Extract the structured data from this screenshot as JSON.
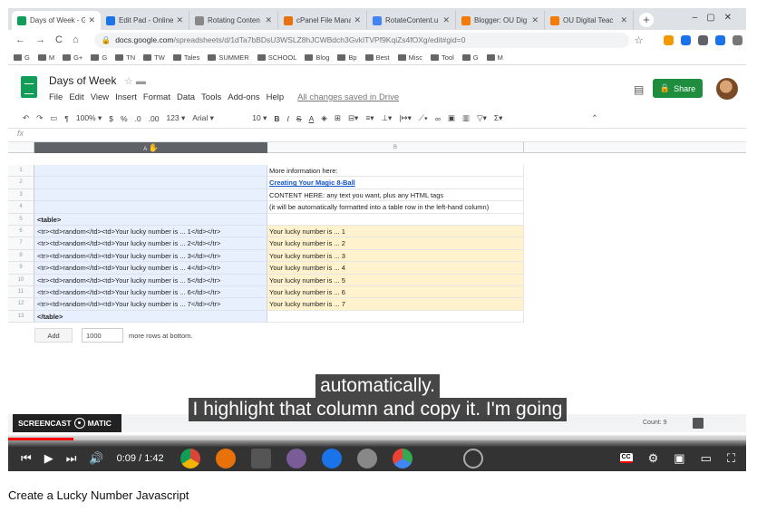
{
  "tabs": [
    {
      "label": "Days of Week - G",
      "color": "#0f9d58",
      "active": true
    },
    {
      "label": "Edit Pad - Online",
      "color": "#1a73e8",
      "active": false
    },
    {
      "label": "Rotating Conten",
      "color": "#888888",
      "active": false
    },
    {
      "label": "cPanel File Mana",
      "color": "#e8710a",
      "active": false
    },
    {
      "label": "RotateContent.u",
      "color": "#4285f4",
      "active": false
    },
    {
      "label": "Blogger: OU Dig",
      "color": "#f57c00",
      "active": false
    },
    {
      "label": "OU Digital Teac",
      "color": "#f57c00",
      "active": false
    }
  ],
  "omnibox": {
    "url_main": "docs.google.com",
    "url_rest": "/spreadsheets/d/1dTa7bBDsU3WSLZ8hJCWBdch3GvkITVPf9KqiZs4fOXg/edit#gid=0"
  },
  "bookmarks": [
    "G",
    "M",
    "G+",
    "G",
    "TN",
    "TW",
    "Tales",
    "SUMMER",
    "SCHOOL",
    "Blog",
    "Bp",
    "Best",
    "Misc",
    "Tool",
    "G",
    "M"
  ],
  "sheet": {
    "title": "Days of Week",
    "menu": [
      "File",
      "Edit",
      "View",
      "Insert",
      "Format",
      "Data",
      "Tools",
      "Add-ons",
      "Help"
    ],
    "saved_text": "All changes saved in Drive",
    "share_label": "Share"
  },
  "toolbar": {
    "zoom": "100%",
    "currency": "$",
    "percent": "%",
    "dec_less": ".0",
    "dec_more": ".00",
    "num_format": "123",
    "font": "Arial",
    "font_size": "10",
    "bold": "B",
    "italic": "I",
    "strike": "S",
    "color_a": "A"
  },
  "fx_label": "fx",
  "columns": {
    "a": "A",
    "b": "B"
  },
  "rows": [
    {
      "n": "1",
      "a": "",
      "b": "More information here:",
      "b_style": ""
    },
    {
      "n": "2",
      "a": "",
      "b": "Creating Your Magic 8-Ball",
      "b_style": "link"
    },
    {
      "n": "3",
      "a": "",
      "b": "CONTENT HERE: any text you want, plus any HTML tags",
      "b_style": ""
    },
    {
      "n": "4",
      "a": "",
      "b": "(it will be automatically formatted into a table row in the left-hand column)",
      "b_style": ""
    },
    {
      "n": "5",
      "a": "<table>",
      "b": "",
      "b_style": ""
    },
    {
      "n": "6",
      "a": "<tr><td>random</td><td>Your lucky number is ... 1</td></tr>",
      "b": "Your lucky number is ... 1",
      "b_style": "yellow"
    },
    {
      "n": "7",
      "a": "<tr><td>random</td><td>Your lucky number is ... 2</td></tr>",
      "b": "Your lucky number is ... 2",
      "b_style": "yellow"
    },
    {
      "n": "8",
      "a": "<tr><td>random</td><td>Your lucky number is ... 3</td></tr>",
      "b": "Your lucky number is ... 3",
      "b_style": "yellow"
    },
    {
      "n": "9",
      "a": "<tr><td>random</td><td>Your lucky number is ... 4</td></tr>",
      "b": "Your lucky number is ... 4",
      "b_style": "yellow"
    },
    {
      "n": "10",
      "a": "<tr><td>random</td><td>Your lucky number is ... 5</td></tr>",
      "b": "Your lucky number is ... 5",
      "b_style": "yellow"
    },
    {
      "n": "11",
      "a": "<tr><td>random</td><td>Your lucky number is ... 6</td></tr>",
      "b": "Your lucky number is ... 6",
      "b_style": "yellow"
    },
    {
      "n": "12",
      "a": "<tr><td>random</td><td>Your lucky number is ... 7</td></tr>",
      "b": "Your lucky number is ... 7",
      "b_style": "yellow"
    },
    {
      "n": "13",
      "a": "</table>",
      "b": "",
      "b_style": ""
    }
  ],
  "add_rows": {
    "button": "Add",
    "value": "1000",
    "suffix": "more rows at bottom."
  },
  "captions": [
    "automatically.",
    "I highlight that column and copy it. I'm going"
  ],
  "screencast_label": "SCREENCAST",
  "screencast_label2": "MATIC",
  "count_label": "Count: 9",
  "player": {
    "current_time": "0:09",
    "duration": "1:42",
    "progress": 0.088,
    "accent": "#ff0000"
  },
  "video_title": "Create a Lucky Number Javascript"
}
